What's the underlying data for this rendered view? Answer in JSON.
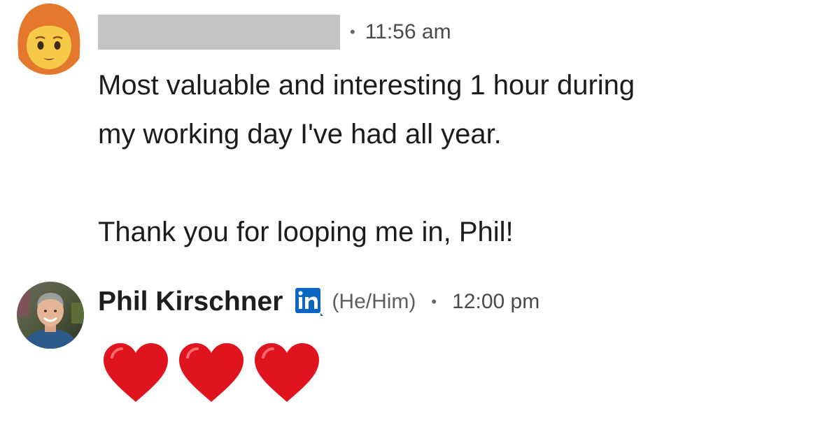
{
  "message_1": {
    "sender_name": "",
    "separator": "•",
    "time": "11:56 am",
    "lines": [
      "Most valuable and interesting 1 hour during",
      "my working day I've had all year.",
      "",
      "Thank you for looping me in, Phil!"
    ],
    "avatar_icon": "woman-red-hair-emoji-icon"
  },
  "message_2": {
    "sender_name": "Phil Kirschner",
    "badge_icon": "linkedin-badge-icon",
    "pronouns": "(He/Him)",
    "separator": "•",
    "time": "12:00 pm",
    "reactions_icon": "red-heart-icon",
    "reaction_count": 3,
    "avatar_icon": "profile-photo-avatar",
    "status_icon": "seen-check-icon"
  },
  "colors": {
    "linkedin_blue": "#0a66c2",
    "heart_red": "#e0141e",
    "redaction_gray": "#c4c4c4",
    "seen_gray": "#6b6b6b"
  }
}
